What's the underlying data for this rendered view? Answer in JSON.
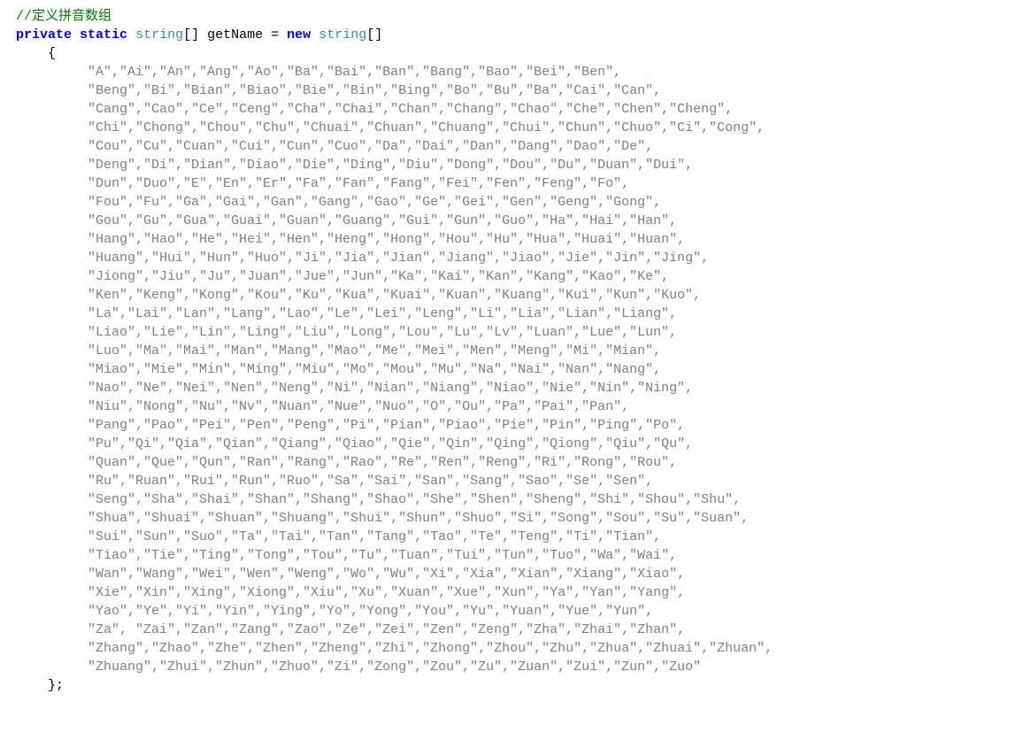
{
  "comment": "//定义拼音数组",
  "decl": {
    "kw_private": "private",
    "kw_static": "static",
    "type": "string",
    "name": "getName",
    "kw_new": "new",
    "type2": "string"
  },
  "lines": [
    "         \"A\",\"Ai\",\"An\",\"Ang\",\"Ao\",\"Ba\",\"Bai\",\"Ban\",\"Bang\",\"Bao\",\"Bei\",\"Ben\",",
    "         \"Beng\",\"Bi\",\"Bian\",\"Biao\",\"Bie\",\"Bin\",\"Bing\",\"Bo\",\"Bu\",\"Ba\",\"Cai\",\"Can\",",
    "         \"Cang\",\"Cao\",\"Ce\",\"Ceng\",\"Cha\",\"Chai\",\"Chan\",\"Chang\",\"Chao\",\"Che\",\"Chen\",\"Cheng\",",
    "         \"Chi\",\"Chong\",\"Chou\",\"Chu\",\"Chuai\",\"Chuan\",\"Chuang\",\"Chui\",\"Chun\",\"Chuo\",\"Ci\",\"Cong\",",
    "         \"Cou\",\"Cu\",\"Cuan\",\"Cui\",\"Cun\",\"Cuo\",\"Da\",\"Dai\",\"Dan\",\"Dang\",\"Dao\",\"De\",",
    "         \"Deng\",\"Di\",\"Dian\",\"Diao\",\"Die\",\"Ding\",\"Diu\",\"Dong\",\"Dou\",\"Du\",\"Duan\",\"Dui\",",
    "         \"Dun\",\"Duo\",\"E\",\"En\",\"Er\",\"Fa\",\"Fan\",\"Fang\",\"Fei\",\"Fen\",\"Feng\",\"Fo\",",
    "         \"Fou\",\"Fu\",\"Ga\",\"Gai\",\"Gan\",\"Gang\",\"Gao\",\"Ge\",\"Gei\",\"Gen\",\"Geng\",\"Gong\",",
    "         \"Gou\",\"Gu\",\"Gua\",\"Guai\",\"Guan\",\"Guang\",\"Gui\",\"Gun\",\"Guo\",\"Ha\",\"Hai\",\"Han\",",
    "         \"Hang\",\"Hao\",\"He\",\"Hei\",\"Hen\",\"Heng\",\"Hong\",\"Hou\",\"Hu\",\"Hua\",\"Huai\",\"Huan\",",
    "         \"Huang\",\"Hui\",\"Hun\",\"Huo\",\"Ji\",\"Jia\",\"Jian\",\"Jiang\",\"Jiao\",\"Jie\",\"Jin\",\"Jing\",",
    "         \"Jiong\",\"Jiu\",\"Ju\",\"Juan\",\"Jue\",\"Jun\",\"Ka\",\"Kai\",\"Kan\",\"Kang\",\"Kao\",\"Ke\",",
    "         \"Ken\",\"Keng\",\"Kong\",\"Kou\",\"Ku\",\"Kua\",\"Kuai\",\"Kuan\",\"Kuang\",\"Kui\",\"Kun\",\"Kuo\",",
    "         \"La\",\"Lai\",\"Lan\",\"Lang\",\"Lao\",\"Le\",\"Lei\",\"Leng\",\"Li\",\"Lia\",\"Lian\",\"Liang\",",
    "         \"Liao\",\"Lie\",\"Lin\",\"Ling\",\"Liu\",\"Long\",\"Lou\",\"Lu\",\"Lv\",\"Luan\",\"Lue\",\"Lun\",",
    "         \"Luo\",\"Ma\",\"Mai\",\"Man\",\"Mang\",\"Mao\",\"Me\",\"Mei\",\"Men\",\"Meng\",\"Mi\",\"Mian\",",
    "         \"Miao\",\"Mie\",\"Min\",\"Ming\",\"Miu\",\"Mo\",\"Mou\",\"Mu\",\"Na\",\"Nai\",\"Nan\",\"Nang\",",
    "         \"Nao\",\"Ne\",\"Nei\",\"Nen\",\"Neng\",\"Ni\",\"Nian\",\"Niang\",\"Niao\",\"Nie\",\"Nin\",\"Ning\",",
    "         \"Niu\",\"Nong\",\"Nu\",\"Nv\",\"Nuan\",\"Nue\",\"Nuo\",\"O\",\"Ou\",\"Pa\",\"Pai\",\"Pan\",",
    "         \"Pang\",\"Pao\",\"Pei\",\"Pen\",\"Peng\",\"Pi\",\"Pian\",\"Piao\",\"Pie\",\"Pin\",\"Ping\",\"Po\",",
    "         \"Pu\",\"Qi\",\"Qia\",\"Qian\",\"Qiang\",\"Qiao\",\"Qie\",\"Qin\",\"Qing\",\"Qiong\",\"Qiu\",\"Qu\",",
    "         \"Quan\",\"Que\",\"Qun\",\"Ran\",\"Rang\",\"Rao\",\"Re\",\"Ren\",\"Reng\",\"Ri\",\"Rong\",\"Rou\",",
    "         \"Ru\",\"Ruan\",\"Rui\",\"Run\",\"Ruo\",\"Sa\",\"Sai\",\"San\",\"Sang\",\"Sao\",\"Se\",\"Sen\",",
    "         \"Seng\",\"Sha\",\"Shai\",\"Shan\",\"Shang\",\"Shao\",\"She\",\"Shen\",\"Sheng\",\"Shi\",\"Shou\",\"Shu\",",
    "         \"Shua\",\"Shuai\",\"Shuan\",\"Shuang\",\"Shui\",\"Shun\",\"Shuo\",\"Si\",\"Song\",\"Sou\",\"Su\",\"Suan\",",
    "         \"Sui\",\"Sun\",\"Suo\",\"Ta\",\"Tai\",\"Tan\",\"Tang\",\"Tao\",\"Te\",\"Teng\",\"Ti\",\"Tian\",",
    "         \"Tiao\",\"Tie\",\"Ting\",\"Tong\",\"Tou\",\"Tu\",\"Tuan\",\"Tui\",\"Tun\",\"Tuo\",\"Wa\",\"Wai\",",
    "         \"Wan\",\"Wang\",\"Wei\",\"Wen\",\"Weng\",\"Wo\",\"Wu\",\"Xi\",\"Xia\",\"Xian\",\"Xiang\",\"Xiao\",",
    "         \"Xie\",\"Xin\",\"Xing\",\"Xiong\",\"Xiu\",\"Xu\",\"Xuan\",\"Xue\",\"Xun\",\"Ya\",\"Yan\",\"Yang\",",
    "         \"Yao\",\"Ye\",\"Yi\",\"Yin\",\"Ying\",\"Yo\",\"Yong\",\"You\",\"Yu\",\"Yuan\",\"Yue\",\"Yun\",",
    "         \"Za\", \"Zai\",\"Zan\",\"Zang\",\"Zao\",\"Ze\",\"Zei\",\"Zen\",\"Zeng\",\"Zha\",\"Zhai\",\"Zhan\",",
    "         \"Zhang\",\"Zhao\",\"Zhe\",\"Zhen\",\"Zheng\",\"Zhi\",\"Zhong\",\"Zhou\",\"Zhu\",\"Zhua\",\"Zhuai\",\"Zhuan\",",
    "         \"Zhuang\",\"Zhui\",\"Zhun\",\"Zhuo\",\"Zi\",\"Zong\",\"Zou\",\"Zu\",\"Zuan\",\"Zui\",\"Zun\",\"Zuo\""
  ],
  "open_brace": "    {",
  "close_brace": "    };"
}
